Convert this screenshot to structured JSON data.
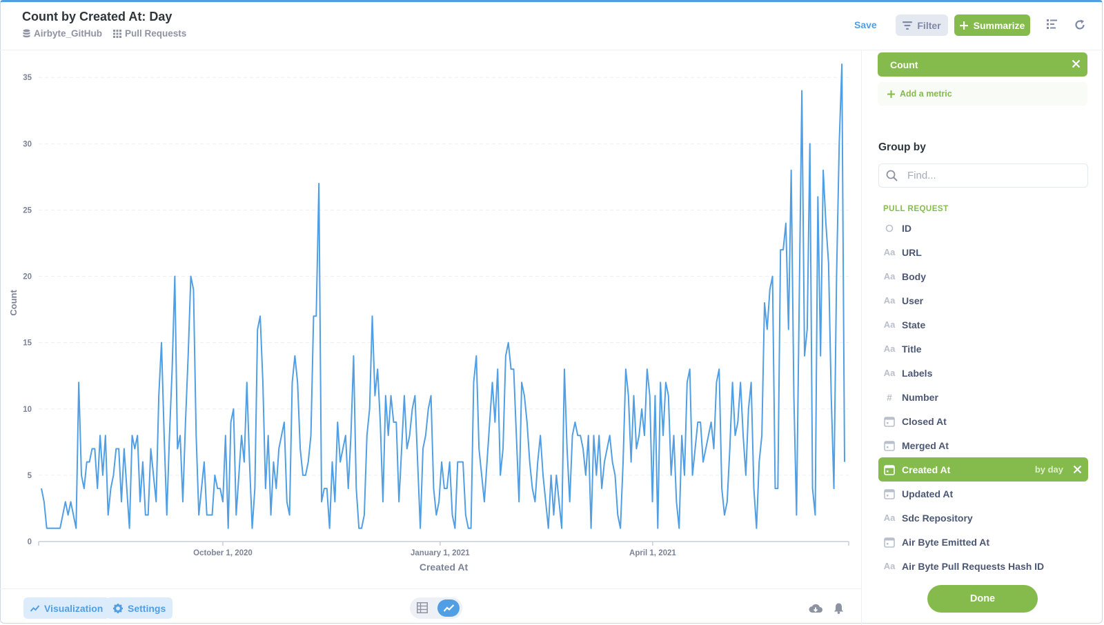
{
  "header": {
    "title": "Count by Created At: Day",
    "database": "Airbyte_GitHub",
    "table": "Pull Requests",
    "save_label": "Save",
    "filter_label": "Filter",
    "summarize_label": "Summarize"
  },
  "footer": {
    "visualization_label": "Visualization",
    "settings_label": "Settings"
  },
  "sidebar": {
    "metric_label": "Count",
    "add_metric_label": "Add a metric",
    "group_by_title": "Group by",
    "search_placeholder": "Find...",
    "section_label": "PULL REQUEST",
    "fields": [
      {
        "label": "ID",
        "icon": "circle-icon",
        "selected": false
      },
      {
        "label": "URL",
        "icon": "text-icon",
        "selected": false
      },
      {
        "label": "Body",
        "icon": "text-icon",
        "selected": false
      },
      {
        "label": "User",
        "icon": "text-icon",
        "selected": false
      },
      {
        "label": "State",
        "icon": "text-icon",
        "selected": false
      },
      {
        "label": "Title",
        "icon": "text-icon",
        "selected": false
      },
      {
        "label": "Labels",
        "icon": "text-icon",
        "selected": false
      },
      {
        "label": "Number",
        "icon": "hash-icon",
        "selected": false
      },
      {
        "label": "Closed At",
        "icon": "calendar-icon",
        "selected": false
      },
      {
        "label": "Merged At",
        "icon": "calendar-icon",
        "selected": false
      },
      {
        "label": "Created At",
        "icon": "calendar-icon",
        "selected": true,
        "bucket": "by day"
      },
      {
        "label": "Updated At",
        "icon": "calendar-icon",
        "selected": false
      },
      {
        "label": "Sdc Repository",
        "icon": "text-icon",
        "selected": false
      },
      {
        "label": "Air Byte Emitted At",
        "icon": "calendar-icon",
        "selected": false
      },
      {
        "label": "Air Byte Pull Requests Hash ID",
        "icon": "text-icon",
        "selected": false
      }
    ],
    "done_label": "Done"
  },
  "colors": {
    "accent_blue": "#509ee3",
    "accent_green": "#84bb4c",
    "line": "#509ee3"
  },
  "chart_data": {
    "type": "line",
    "title": "",
    "xlabel": "Created At",
    "ylabel": "Count",
    "ylim": [
      0,
      36
    ],
    "yticks": [
      0,
      5,
      10,
      15,
      20,
      25,
      30,
      35
    ],
    "x_start": "2020-07-15",
    "x_end": "2021-06-23",
    "xticks": [
      {
        "date": "2020-10-01",
        "label": "October 1, 2020"
      },
      {
        "date": "2021-01-01",
        "label": "January 1, 2021"
      },
      {
        "date": "2021-04-01",
        "label": "April 1, 2021"
      }
    ],
    "grid": true,
    "series": [
      {
        "values": [
          4,
          3,
          1,
          1,
          1,
          1,
          1,
          1,
          2,
          3,
          2,
          3,
          2,
          1,
          12,
          5,
          4,
          6,
          6,
          7,
          7,
          4,
          8,
          5,
          8,
          2,
          4,
          5,
          7,
          7,
          3,
          7,
          4,
          1,
          8,
          7,
          8,
          3,
          6,
          2,
          2,
          7,
          5,
          3,
          11,
          15,
          8,
          2,
          8,
          13,
          20,
          7,
          8,
          3,
          9,
          14,
          20,
          19,
          8,
          2,
          4,
          6,
          2,
          2,
          2,
          5,
          4,
          4,
          3,
          8,
          1,
          9,
          10,
          2,
          5,
          8,
          6,
          12,
          6,
          1,
          4,
          16,
          17,
          12,
          4,
          8,
          2,
          6,
          4,
          7,
          8,
          9,
          3,
          2,
          12,
          14,
          12,
          7,
          5,
          5,
          6,
          8,
          17,
          17,
          27,
          3,
          4,
          4,
          1,
          6,
          3,
          9,
          6,
          7,
          8,
          4,
          8,
          14,
          4,
          1,
          1,
          2,
          8,
          10,
          17,
          11,
          13,
          9,
          3,
          11,
          8,
          11,
          9,
          9,
          3,
          7,
          11,
          7,
          8,
          10,
          11,
          6,
          1,
          7,
          8,
          10,
          11,
          4,
          2,
          3,
          6,
          4,
          4,
          6,
          2,
          1,
          6,
          6,
          6,
          2,
          1,
          1,
          12,
          14,
          7,
          5,
          3,
          6,
          9,
          12,
          9,
          13,
          5,
          7,
          14,
          15,
          13,
          13,
          8,
          3,
          12,
          11,
          9,
          6,
          4,
          3,
          6,
          8,
          5,
          3,
          1,
          5,
          2,
          5,
          3,
          1,
          13,
          7,
          3,
          8,
          9,
          8,
          8,
          7,
          5,
          8,
          1,
          8,
          5,
          8,
          4,
          6,
          7,
          8,
          6,
          5,
          2,
          1,
          6,
          13,
          11,
          6,
          11,
          7,
          8,
          10,
          8,
          13,
          11,
          3,
          11,
          1,
          12,
          8,
          12,
          11,
          5,
          8,
          3,
          1,
          8,
          5,
          12,
          13,
          5,
          7,
          9,
          9,
          6,
          7,
          8,
          9,
          7,
          12,
          13,
          4,
          2,
          3,
          7,
          12,
          8,
          9,
          12,
          8,
          5,
          10,
          12,
          4,
          1,
          6,
          8,
          18,
          16,
          19,
          20,
          4,
          4,
          22,
          22,
          24,
          16,
          28,
          11,
          2,
          18,
          34,
          14,
          16,
          30,
          4,
          2,
          26,
          14,
          28,
          24,
          21,
          11,
          4,
          20,
          30,
          36,
          6
        ]
      }
    ]
  }
}
